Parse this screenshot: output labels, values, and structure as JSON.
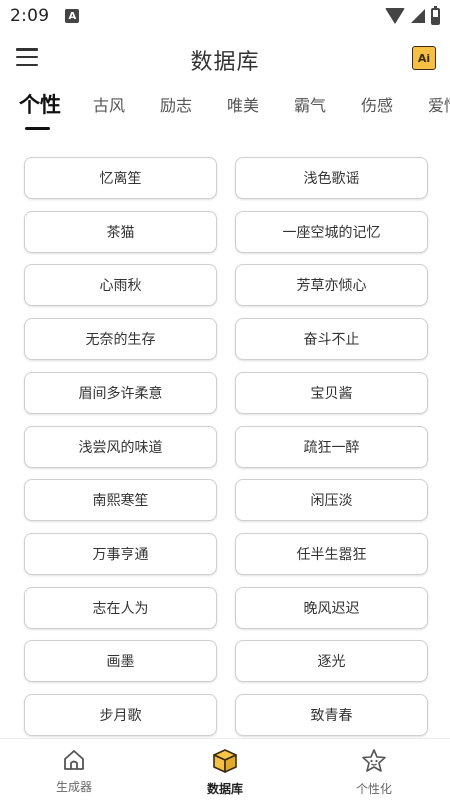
{
  "status": {
    "time": "2:09",
    "notification_letter": "A"
  },
  "app_bar": {
    "title": "数据库",
    "ai_badge": "Ai"
  },
  "tabs": [
    {
      "label": "个性",
      "active": true
    },
    {
      "label": "古风",
      "active": false
    },
    {
      "label": "励志",
      "active": false
    },
    {
      "label": "唯美",
      "active": false
    },
    {
      "label": "霸气",
      "active": false
    },
    {
      "label": "伤感",
      "active": false
    },
    {
      "label": "爱情",
      "active": false
    }
  ],
  "names": [
    [
      "忆离笙",
      "浅色歌谣"
    ],
    [
      "茶猫",
      "一座空城的记忆"
    ],
    [
      "心雨秋",
      "芳草亦倾心"
    ],
    [
      "无奈的生存",
      "奋斗不止"
    ],
    [
      "眉间多许柔意",
      "宝贝酱"
    ],
    [
      "浅尝风的味道",
      "疏狂一醉"
    ],
    [
      "南熙寒笙",
      "闲压淡"
    ],
    [
      "万事亨通",
      "任半生嚣狂"
    ],
    [
      "志在人为",
      "晚风迟迟"
    ],
    [
      "画墨",
      "逐光"
    ],
    [
      "步月歌",
      "致青春"
    ]
  ],
  "bottom_nav": [
    {
      "label": "生成器",
      "icon": "home-icon",
      "active": false
    },
    {
      "label": "数据库",
      "icon": "database-box-icon",
      "active": true
    },
    {
      "label": "个性化",
      "icon": "star-face-icon",
      "active": false
    }
  ],
  "colors": {
    "accent": "#f5c043",
    "accent_dark": "#3a2a10",
    "text": "#333333",
    "border": "#cfcfcf"
  }
}
